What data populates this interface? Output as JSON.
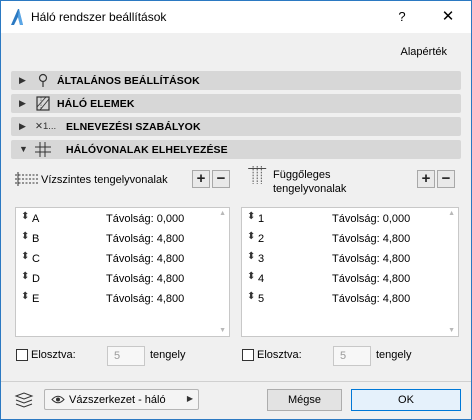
{
  "window": {
    "title": "Háló rendszer beállítások",
    "help_label": "?",
    "close_label": "✕",
    "accent_color": "#2b79c2"
  },
  "defaults_label": "Alapérték",
  "sections": [
    {
      "label": "ÁLTALÁNOS BEÁLLÍTÁSOK",
      "icon": "location-pin-icon",
      "expanded": false,
      "arrow": "▶"
    },
    {
      "label": "HÁLÓ ELEMEK",
      "icon": "grid-element-icon",
      "expanded": false,
      "arrow": "▶"
    },
    {
      "label": "ELNEVEZÉSI SZABÁLYOK",
      "icon_text": "✕1...",
      "icon": "naming-icon",
      "expanded": false,
      "arrow": "▶"
    },
    {
      "label": "HÁLÓVONALAK ELHELYEZÉSE",
      "icon": "grid-lines-icon",
      "expanded": true,
      "arrow": "▼"
    }
  ],
  "horizontal": {
    "title": "Vízszintes tengelyvonalak",
    "add_label": "+",
    "remove_label": "−",
    "rows": [
      {
        "name": "A",
        "distance": "Távolság: 0,000"
      },
      {
        "name": "B",
        "distance": "Távolság: 4,800"
      },
      {
        "name": "C",
        "distance": "Távolság: 4,800"
      },
      {
        "name": "D",
        "distance": "Távolság: 4,800"
      },
      {
        "name": "E",
        "distance": "Távolság: 4,800"
      }
    ],
    "distribute_label": "Elosztva:",
    "count_value": "5",
    "unit_label": "tengely"
  },
  "vertical": {
    "title_line1": "Függőleges",
    "title_line2": "tengelyvonalak",
    "add_label": "+",
    "remove_label": "−",
    "rows": [
      {
        "name": "1",
        "distance": "Távolság: 0,000"
      },
      {
        "name": "2",
        "distance": "Távolság: 4,800"
      },
      {
        "name": "3",
        "distance": "Távolság: 4,800"
      },
      {
        "name": "4",
        "distance": "Távolság: 4,800"
      },
      {
        "name": "5",
        "distance": "Távolság: 4,800"
      }
    ],
    "distribute_label": "Elosztva:",
    "count_value": "5",
    "unit_label": "tengely"
  },
  "footer": {
    "view_label": "Vázszerkezet - háló",
    "cancel_label": "Mégse",
    "ok_label": "OK"
  }
}
